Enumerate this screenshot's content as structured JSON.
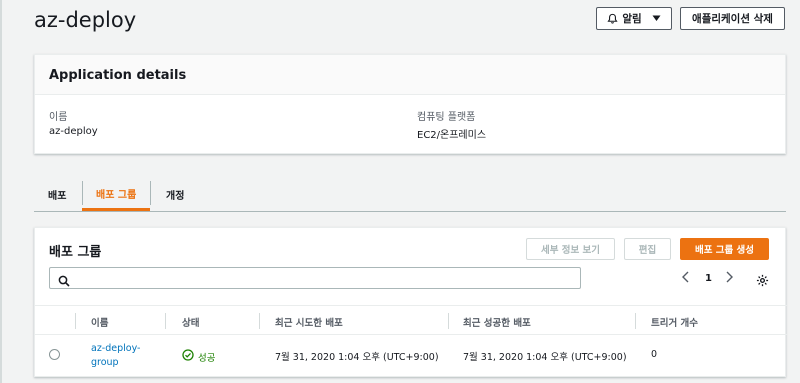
{
  "header": {
    "title": "az-deploy",
    "alarm_label": "알림",
    "delete_label": "애플리케이션 삭제"
  },
  "details": {
    "title": "Application details",
    "name_label": "이름",
    "name_value": "az-deploy",
    "platform_label": "컴퓨팅 플랫폼",
    "platform_value": "EC2/온프레미스"
  },
  "tabs": [
    {
      "label": "배포",
      "active": false
    },
    {
      "label": "배포 그룹",
      "active": true
    },
    {
      "label": "개정",
      "active": false
    }
  ],
  "groups": {
    "title": "배포 그룹",
    "view_details_label": "세부 정보 보기",
    "edit_label": "편집",
    "create_label": "배포 그룹 생성",
    "search_placeholder": "",
    "page": "1",
    "columns": [
      "이름",
      "상태",
      "최근 시도한 배포",
      "최근 성공한 배포",
      "트리거 개수"
    ],
    "rows": [
      {
        "name_line1": "az-deploy-",
        "name_line2": "group",
        "status": "성공",
        "last_attempted": "7월 31, 2020 1:04 오후 (UTC+9:00)",
        "last_succeeded": "7월 31, 2020 1:04 오후 (UTC+9:00)",
        "triggers": "0"
      }
    ]
  },
  "colors": {
    "accent": "#ec7211",
    "link": "#0073bb",
    "success": "#1d8102"
  },
  "icons": [
    "bell-icon",
    "caret-down-icon",
    "search-icon",
    "chevron-left-icon",
    "chevron-right-icon",
    "gear-icon",
    "success-check-icon"
  ]
}
